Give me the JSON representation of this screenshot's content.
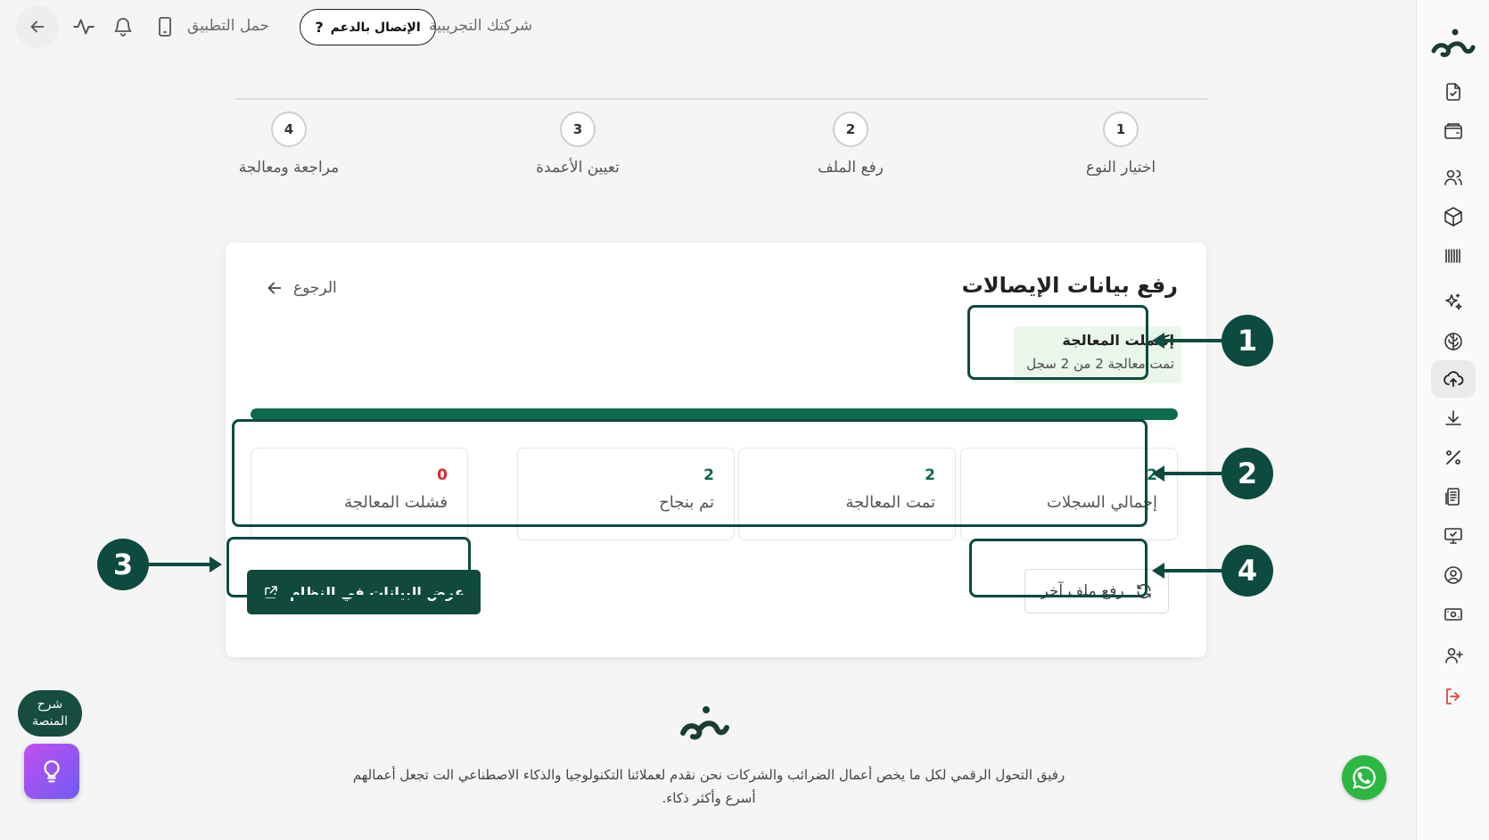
{
  "topbar": {
    "company_name": "شركتك التجريبية",
    "support_label": "الإتصال بالدعم",
    "support_icon": "question-mark-icon",
    "download_app_label": "حمل التطبيق"
  },
  "stepper": {
    "steps": [
      {
        "number": "1",
        "label": "اختيار النوع"
      },
      {
        "number": "2",
        "label": "رفع الملف"
      },
      {
        "number": "3",
        "label": "تعيين الأعمدة"
      },
      {
        "number": "4",
        "label": "مراجعة ومعالجة"
      }
    ]
  },
  "card": {
    "title": "رفع بيانات الإيصالات",
    "back_label": "الرجوع",
    "status": {
      "title": "إكتملت المعالجة",
      "subtitle": "تمت معالجة 2 من 2 سجل"
    },
    "progress_fraction": 1.0,
    "stats": [
      {
        "value": "2",
        "label": "إجمالي السجلات"
      },
      {
        "value": "2",
        "label": "تمت المعالجة"
      },
      {
        "value": "2",
        "label": "تم بنجاح"
      },
      {
        "value": "0",
        "label": "فشلت المعالجة"
      }
    ],
    "view_data_label": "عرض البيانات في النظام",
    "upload_another_label": "رفع ملف آخر"
  },
  "annotations": {
    "badges": [
      "1",
      "2",
      "3",
      "4"
    ]
  },
  "footer": {
    "tagline_line1": "رفيق التحول الرقمي لكل ما يخص أعمال الضرائب والشركات نحن نقدم لعملائنا التكنولوجيا والذكاء الاصطناعي الت تجعل أعمالهم",
    "tagline_line2": "أسرع وأكثر ذكاء."
  },
  "widgets": {
    "explain_line1": "شرح",
    "explain_line2": "المنصة"
  },
  "colors": {
    "brand_dark": "#11493d",
    "brand_green": "#0c6b4d",
    "status_bg": "#e9f6ea",
    "fail_red": "#e0242a",
    "logout_red": "#e0453a",
    "whatsapp": "#2bb741"
  },
  "sidebar": {
    "items": [
      {
        "icon": "file-check-icon"
      },
      {
        "icon": "wallet-icon"
      },
      {
        "icon": "users-icon"
      },
      {
        "icon": "package-icon"
      },
      {
        "icon": "barcode-icon"
      },
      {
        "icon": "sparkles-icon"
      },
      {
        "icon": "brain-icon"
      },
      {
        "icon": "cloud-upload-icon",
        "active": true
      },
      {
        "icon": "download-icon"
      },
      {
        "icon": "percent-icon"
      },
      {
        "icon": "receipt-icon"
      },
      {
        "icon": "monitor-icon"
      },
      {
        "icon": "user-circle-icon"
      },
      {
        "icon": "banknote-icon"
      },
      {
        "icon": "user-plus-icon"
      },
      {
        "icon": "logout-icon"
      }
    ]
  }
}
